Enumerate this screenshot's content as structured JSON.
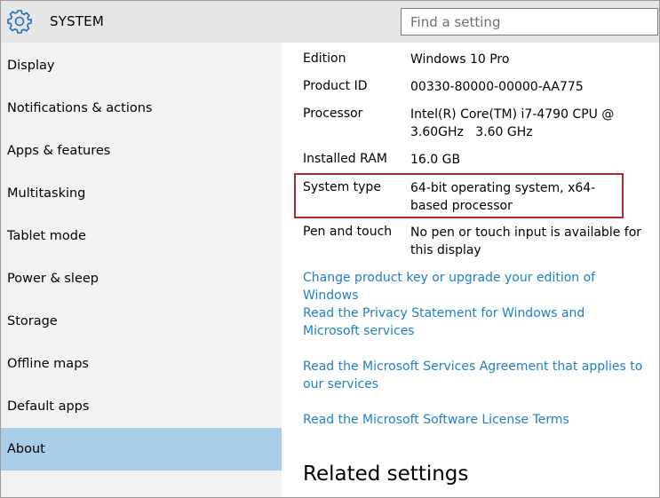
{
  "header": {
    "title": "SYSTEM",
    "icon": "gear-icon",
    "search_placeholder": "Find a setting"
  },
  "sidebar": {
    "items": [
      {
        "label": "Display"
      },
      {
        "label": "Notifications & actions"
      },
      {
        "label": "Apps & features"
      },
      {
        "label": "Multitasking"
      },
      {
        "label": "Tablet mode"
      },
      {
        "label": "Power & sleep"
      },
      {
        "label": "Storage"
      },
      {
        "label": "Offline maps"
      },
      {
        "label": "Default apps"
      },
      {
        "label": "About",
        "selected": true
      }
    ]
  },
  "about": {
    "rows": [
      {
        "label": "Edition",
        "value": "Windows 10 Pro"
      },
      {
        "label": "Product ID",
        "value": "00330-80000-00000-AA775"
      },
      {
        "label": "Processor",
        "value": "Intel(R) Core(TM) i7-4790 CPU @ 3.60GHz   3.60 GHz"
      },
      {
        "label": "Installed RAM",
        "value": "16.0 GB"
      },
      {
        "label": "System type",
        "value": "64-bit operating system, x64-based processor",
        "highlighted": true
      },
      {
        "label": "Pen and touch",
        "value": "No pen or touch input is available for this display"
      }
    ],
    "links": [
      "Change product key or upgrade your edition of Windows",
      "Read the Privacy Statement for Windows and Microsoft services",
      "Read the Microsoft Services Agreement that applies to our services",
      "Read the Microsoft Software License Terms"
    ],
    "related_heading": "Related settings"
  },
  "colors": {
    "accent_link": "#1e7fc9",
    "selected_nav": "#a9cde6",
    "highlight_border": "#b2282b",
    "header_bg": "#e6e6e6",
    "sidebar_bg": "#f2f2f2"
  }
}
